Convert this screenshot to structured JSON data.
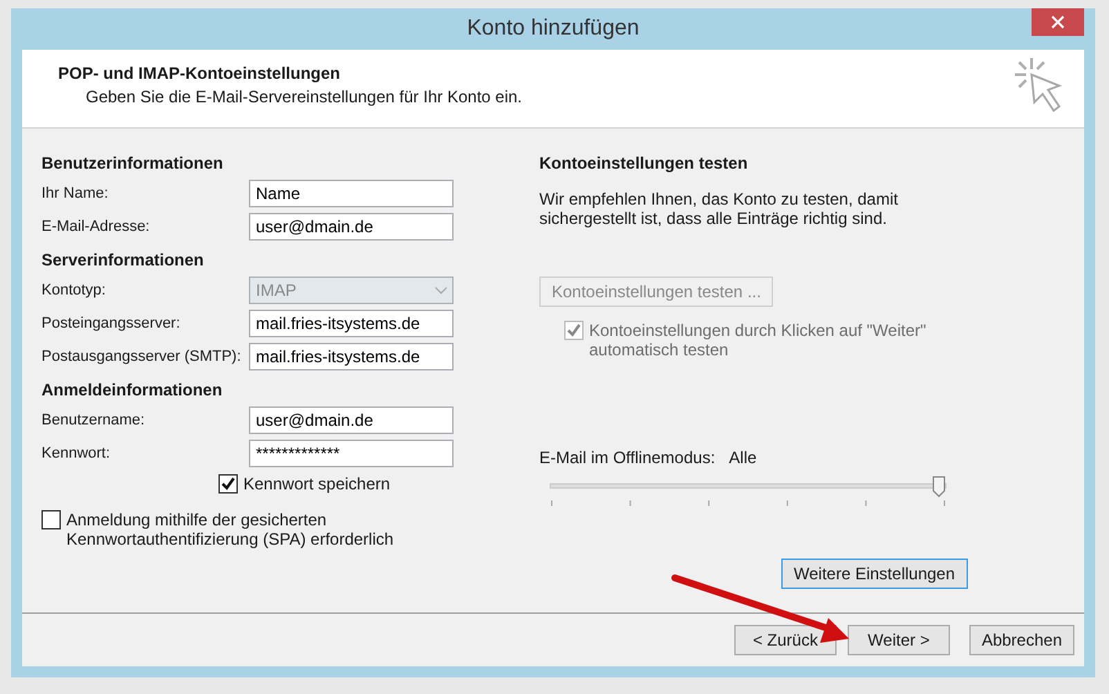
{
  "window": {
    "title": "Konto hinzufügen"
  },
  "header": {
    "title": "POP- und IMAP-Kontoeinstellungen",
    "subtitle": "Geben Sie die E-Mail-Servereinstellungen für Ihr Konto ein."
  },
  "sections": [
    {
      "heading": "Benutzerinformationen",
      "fields": [
        {
          "label": "Ihr Name:",
          "value": "Name",
          "kind": "text",
          "disabled": false
        },
        {
          "label": "E-Mail-Adresse:",
          "value": "user@dmain.de",
          "kind": "text",
          "disabled": false
        }
      ]
    },
    {
      "heading": "Serverinformationen",
      "fields": [
        {
          "label": "Kontotyp:",
          "value": "IMAP",
          "kind": "dropdown",
          "disabled": true
        },
        {
          "label": "Posteingangsserver:",
          "value": "mail.fries-itsystems.de",
          "kind": "text",
          "disabled": false
        },
        {
          "label": "Postausgangsserver (SMTP):",
          "value": "mail.fries-itsystems.de",
          "kind": "text",
          "disabled": false
        }
      ]
    },
    {
      "heading": "Anmeldeinformationen",
      "fields": [
        {
          "label": "Benutzername:",
          "value": "user@dmain.de",
          "kind": "text",
          "disabled": false
        },
        {
          "label": "Kennwort:",
          "value": "*************",
          "kind": "text",
          "disabled": false
        }
      ]
    }
  ],
  "remember_password": {
    "label": "Kennwort speichern",
    "checked": true
  },
  "spa": {
    "label": "Anmeldung mithilfe der gesicherten Kennwortauthentifizierung (SPA) erforderlich",
    "checked": false
  },
  "test": {
    "heading": "Kontoeinstellungen testen",
    "description": "Wir empfehlen Ihnen, das Konto zu testen, damit sichergestellt ist, dass alle Einträge richtig sind.",
    "button": {
      "label": "Kontoeinstellungen testen ...",
      "disabled": true
    },
    "auto_test": {
      "label": "Kontoeinstellungen durch Klicken auf \"Weiter\" automatisch testen",
      "checked": true,
      "disabled": true
    }
  },
  "offline": {
    "label": "E-Mail im Offlinemodus:",
    "value": "Alle",
    "level": 1
  },
  "more_button": {
    "label": "Weitere Einstellungen",
    "focused": true
  },
  "footer_buttons": [
    {
      "label": "< Zurück"
    },
    {
      "label": "Weiter >"
    },
    {
      "label": "Abbrechen"
    }
  ]
}
